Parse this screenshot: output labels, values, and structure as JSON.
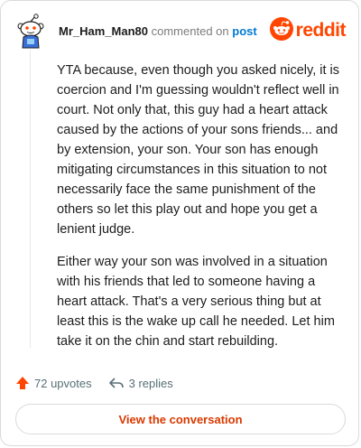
{
  "comment": {
    "username": "Mr_Ham_Man80",
    "action_text": "commented on",
    "post_link": "post",
    "paragraphs": [
      "YTA because, even though you asked nicely, it is coercion and I'm guessing wouldn't reflect well in court. Not only that, this guy had a heart attack caused by the actions of your sons friends... and by extension, your son. Your son has enough mitigating circumstances in this situation to not necessarily face the same punishment of the others so let this play out and hope you get a lenient judge.",
      "Either way your son was involved in a situation with his friends that led to someone having a heart attack. That's a very serious thing but at least this is the wake up call he needed. Let him take it on the chin and start rebuilding."
    ]
  },
  "brand": {
    "name": "reddit",
    "icon": "reddit-snoo-icon",
    "color": "#ff4500"
  },
  "avatar": {
    "icon": "snoo-avatar-icon"
  },
  "stats": {
    "upvotes_label": "72 upvotes",
    "upvote_icon": "upvote-arrow-icon",
    "upvote_color": "#ff4500",
    "replies_label": "3 replies",
    "reply_icon": "reply-arrow-icon"
  },
  "cta": {
    "label": "View the conversation",
    "color": "#d93900"
  }
}
